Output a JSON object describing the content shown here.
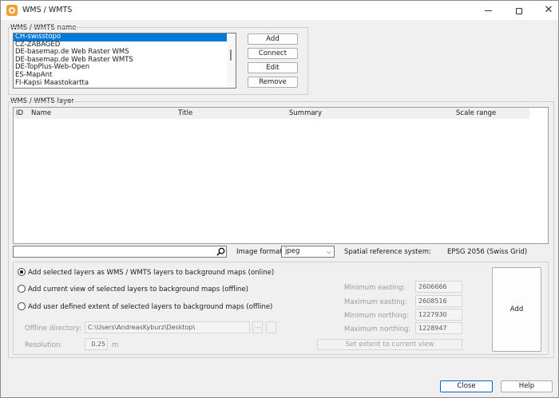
{
  "window": {
    "title": "WMS / WMTS"
  },
  "services": {
    "group_label": "WMS / WMTS name",
    "items": [
      "CH-swisstopo",
      "CZ-ZABAGED",
      "DE-basemap.de Web Raster WMS",
      "DE-basemap.de Web Raster WMTS",
      "DE-TopPlus-Web-Open",
      "ES-MapAnt",
      "FI-Kapsi Maastokartta"
    ],
    "selected_index": 0,
    "buttons": {
      "add": "Add",
      "connect": "Connect",
      "edit": "Edit",
      "remove": "Remove"
    }
  },
  "layers": {
    "group_label": "WMS / WMTS layer",
    "columns": [
      "ID",
      "Name",
      "Title",
      "Summary",
      "Scale range"
    ],
    "rows": []
  },
  "search": {
    "value": "",
    "icon": "magnifier-icon"
  },
  "image_format": {
    "label": "Image format:",
    "value": "jpeg"
  },
  "srs": {
    "label": "Spatial reference system:",
    "value": "EPSG 2056 (Swiss Grid)"
  },
  "options": {
    "online": "Add selected layers as WMS / WMTS layers to background maps (online)",
    "current_view": "Add current view of selected layers to background maps (offline)",
    "user_extent": "Add user defined extent of selected layers to background maps (offline)",
    "selected": "online"
  },
  "offline": {
    "directory_label": "Offline directory:",
    "directory_value": "C:\\Users\\AndreasKyburz\\Desktop\\",
    "browse_label": "...",
    "resolution_label": "Resolution:",
    "resolution_value": "0.25",
    "resolution_unit": "m"
  },
  "extent": {
    "min_easting_label": "Minimum easting:",
    "min_easting": "2606666",
    "max_easting_label": "Maximum easting:",
    "max_easting": "2608516",
    "min_northing_label": "Minimum northing:",
    "min_northing": "1227930",
    "max_northing_label": "Maximum northing:",
    "max_northing": "1228947",
    "set_extent_label": "Set extent to current view"
  },
  "actions": {
    "add": "Add",
    "close": "Close",
    "help": "Help"
  }
}
